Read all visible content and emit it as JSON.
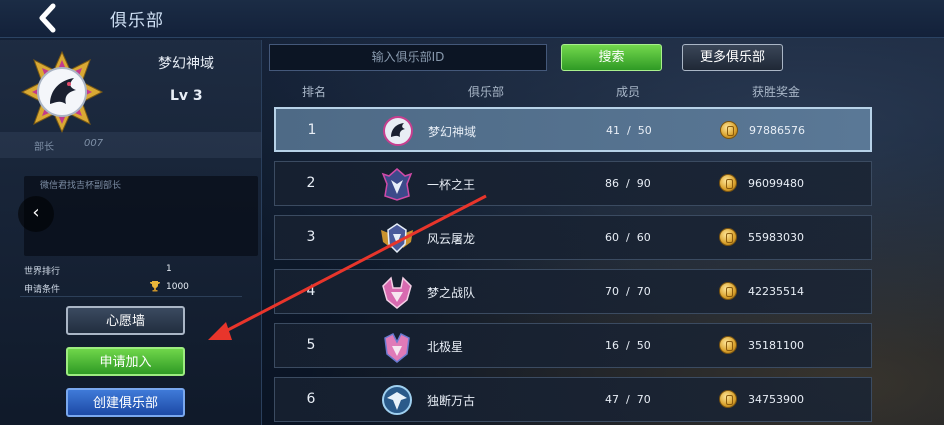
{
  "header": {
    "title": "俱乐部",
    "back_icon": "back-arrow-icon"
  },
  "club": {
    "name": "梦幻神域",
    "level": "Lv 3",
    "leader_label": "部长",
    "leader_value": "007",
    "notice": "微信君找吉杯副部长",
    "world_rank_label": "世界排行",
    "world_rank_value": "1",
    "requirement_label": "申请条件",
    "requirement_value": "1000"
  },
  "buttons": {
    "wish_wall": "心愿墙",
    "apply_join": "申请加入",
    "create_club": "创建俱乐部"
  },
  "search": {
    "placeholder": "输入俱乐部ID",
    "search_label": "搜索",
    "more_label": "更多俱乐部"
  },
  "table": {
    "headers": [
      "排名",
      "俱乐部",
      "成员",
      "获胜奖金"
    ],
    "rows": [
      {
        "rank": "1",
        "name": "梦幻神域",
        "members": "41  /  50",
        "prize": "97886576",
        "selected": true
      },
      {
        "rank": "2",
        "name": "一杯之王",
        "members": "86  /  90",
        "prize": "96099480",
        "selected": false
      },
      {
        "rank": "3",
        "name": "风云屠龙",
        "members": "60  /  60",
        "prize": "55983030",
        "selected": false
      },
      {
        "rank": "4",
        "name": "梦之战队",
        "members": "70  /  70",
        "prize": "42235514",
        "selected": false
      },
      {
        "rank": "5",
        "name": "北极星",
        "members": "16  /  50",
        "prize": "35181100",
        "selected": false
      },
      {
        "rank": "6",
        "name": "独断万古",
        "members": "47  /  70",
        "prize": "34753900",
        "selected": false
      }
    ]
  },
  "colors": {
    "accent_green": "#2f9a25",
    "accent_blue": "#1d4aa6",
    "selected_row": "#5a7896",
    "annotation_arrow": "#e8352b"
  }
}
